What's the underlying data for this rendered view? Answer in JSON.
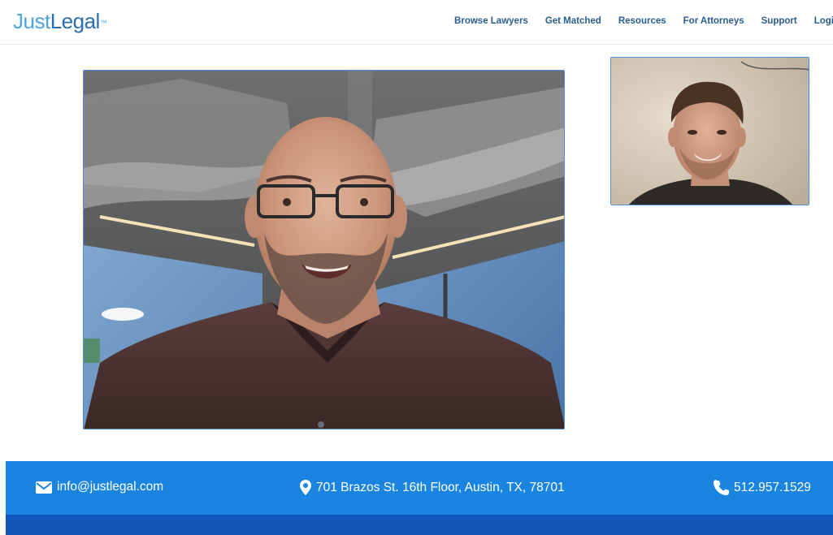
{
  "brand": {
    "logo_part1": "Just",
    "logo_part2": "Legal",
    "logo_mark": "™"
  },
  "nav": {
    "items": [
      {
        "label": "Browse Lawyers"
      },
      {
        "label": "Get Matched"
      },
      {
        "label": "Resources"
      },
      {
        "label": "For Attorneys"
      },
      {
        "label": "Support"
      },
      {
        "label": "Login"
      }
    ]
  },
  "video": {
    "main_feed": "remote-participant-video",
    "self_feed": "self-view-video"
  },
  "footer": {
    "email": "info@justlegal.com",
    "address": "701 Brazos St. 16th Floor, Austin, TX, 78701",
    "phone": "512.957.1529"
  },
  "colors": {
    "accent": "#1a85e0",
    "footer_dark": "#0f56b8",
    "nav_text": "#2a5d8f",
    "video_border": "#4a90d9"
  },
  "icons": {
    "email": "envelope-icon",
    "address": "map-pin-icon",
    "phone": "phone-icon"
  }
}
